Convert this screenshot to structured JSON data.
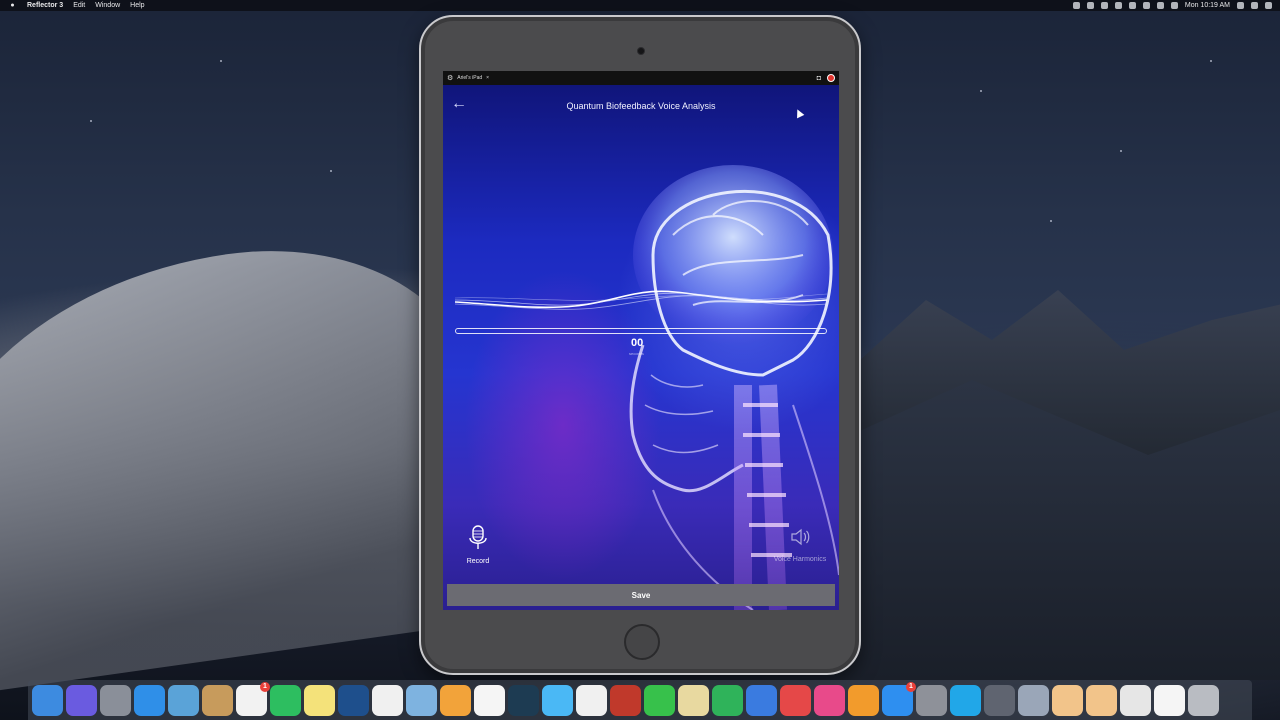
{
  "menubar": {
    "app_name": "Reflector 3",
    "items": [
      "Edit",
      "Window",
      "Help"
    ],
    "clock": "Mon 10:19 AM"
  },
  "reflector": {
    "device_name": "Ariel's iPad",
    "close_symbol": "×"
  },
  "app": {
    "title": "Quantum Biofeedback Voice Analysis",
    "timer": "00",
    "timer_sub": "seconds",
    "record_label": "Record",
    "harmonics_label": "Voice Harmonics",
    "save_label": "Save"
  },
  "dock": {
    "items": [
      {
        "name": "finder-icon",
        "color": "#3d8be0"
      },
      {
        "name": "siri-icon",
        "color": "#6a5be0"
      },
      {
        "name": "launchpad-icon",
        "color": "#8a8f99"
      },
      {
        "name": "safari-icon",
        "color": "#2f8fe8"
      },
      {
        "name": "preview-icon",
        "color": "#5aa3d8"
      },
      {
        "name": "notefile-icon",
        "color": "#c79b5c"
      },
      {
        "name": "calendar-icon",
        "color": "#f2f2f2",
        "badge": "1"
      },
      {
        "name": "evernote-icon",
        "color": "#2dbe60"
      },
      {
        "name": "notes-icon",
        "color": "#f4e27a"
      },
      {
        "name": "quicktime-icon",
        "color": "#1e4f8c"
      },
      {
        "name": "textedit-icon",
        "color": "#f0f0f0"
      },
      {
        "name": "photos-viewer-icon",
        "color": "#7eb3e0"
      },
      {
        "name": "pages-icon",
        "color": "#f2a33a"
      },
      {
        "name": "photos-icon",
        "color": "#f5f5f5"
      },
      {
        "name": "kindle-icon",
        "color": "#1d3b52"
      },
      {
        "name": "messages-icon",
        "color": "#4ab8f5"
      },
      {
        "name": "chrome-icon",
        "color": "#f0f0f0"
      },
      {
        "name": "photo-booth-icon",
        "color": "#c0392b"
      },
      {
        "name": "facetime-icon",
        "color": "#37c14b"
      },
      {
        "name": "keynote-prep-icon",
        "color": "#e8d9a0"
      },
      {
        "name": "numbers-icon",
        "color": "#2fb35a"
      },
      {
        "name": "keynote-icon",
        "color": "#3a7be0"
      },
      {
        "name": "news-icon",
        "color": "#e54848"
      },
      {
        "name": "itunes-icon",
        "color": "#e84a8a"
      },
      {
        "name": "books-icon",
        "color": "#f29b2c"
      },
      {
        "name": "app-store-icon",
        "color": "#2e8ff0",
        "badge": "1"
      },
      {
        "name": "system-preferences-icon",
        "color": "#8e9199"
      },
      {
        "name": "skype-icon",
        "color": "#21a7e8"
      },
      {
        "name": "screenshot-icon",
        "color": "#5f6470"
      },
      {
        "name": "image-capture-icon",
        "color": "#9aa6b8"
      },
      {
        "name": "flower-app-icon",
        "color": "#f2c48a"
      },
      {
        "name": "flower-app-2-icon",
        "color": "#f2c48a"
      },
      {
        "name": "window-manager-icon",
        "color": "#e6e6e6"
      },
      {
        "name": "document-icon",
        "color": "#f5f5f5"
      },
      {
        "name": "trash-icon",
        "color": "#b9bcc2"
      }
    ]
  }
}
